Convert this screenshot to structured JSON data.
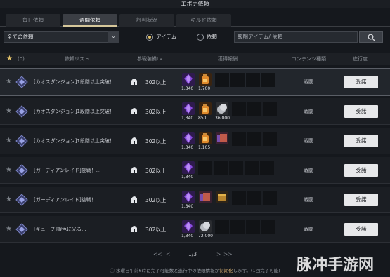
{
  "window": {
    "title": "エポナ依頼"
  },
  "tabs": [
    {
      "label": "毎日依頼",
      "active": false
    },
    {
      "label": "週間依頼",
      "active": true
    },
    {
      "label": "評判状況",
      "active": false
    },
    {
      "label": "ギルド依頼",
      "active": false
    }
  ],
  "filter": {
    "select_value": "全ての依頼",
    "radio_item": "アイテム",
    "radio_quest": "依頼",
    "search_placeholder": "報酬アイテム/ 依頼"
  },
  "table": {
    "fav_count": "(0)",
    "headers": {
      "list": "依頼リスト",
      "level": "参戦装備Lv",
      "reward": "獲得報酬",
      "content_type": "コンテンツ種類",
      "progress": "進行度"
    },
    "rows": [
      {
        "name": "[カオスダンジョン]1段階以上突破！",
        "level": "302以上",
        "rewards": [
          {
            "icon": "purple-crystal-icon",
            "count": "1,340"
          },
          {
            "icon": "orange-potion-icon",
            "count": "1,700"
          }
        ],
        "content_type": "戦闘",
        "action": "受諾",
        "selected": true
      },
      {
        "name": "[カオスダンジョン]1段階以上突破！",
        "level": "302以上",
        "rewards": [
          {
            "icon": "purple-crystal-icon",
            "count": "1,340"
          },
          {
            "icon": "orange-potion-icon",
            "count": "850"
          },
          {
            "icon": "silver-coin-icon",
            "count": "36,000"
          }
        ],
        "content_type": "戦闘",
        "action": "受諾",
        "selected": false
      },
      {
        "name": "[カオスダンジョン]1段階以上突破！",
        "level": "302以上",
        "rewards": [
          {
            "icon": "purple-crystal-icon",
            "count": "1,340"
          },
          {
            "icon": "orange-potion-icon",
            "count": "1,105"
          },
          {
            "icon": "card-pack-icon",
            "count": ""
          }
        ],
        "content_type": "戦闘",
        "action": "受諾",
        "selected": false
      },
      {
        "name": "[ガーディアンレイド]挑戦！...",
        "level": "302以上",
        "rewards": [
          {
            "icon": "purple-crystal-icon",
            "count": "1,340"
          }
        ],
        "content_type": "戦闘",
        "action": "受諾",
        "selected": false
      },
      {
        "name": "[ガーディアンレイド]挑戦！...",
        "level": "302以上",
        "rewards": [
          {
            "icon": "purple-crystal-icon",
            "count": "1,340"
          },
          {
            "icon": "card-pack-icon",
            "count": ""
          },
          {
            "icon": "gold-chest-icon",
            "count": ""
          }
        ],
        "content_type": "戦闘",
        "action": "受諾",
        "selected": false
      },
      {
        "name": "[キューブ]銀色に光る...",
        "level": "302以上",
        "rewards": [
          {
            "icon": "purple-crystal-icon",
            "count": "1,340"
          },
          {
            "icon": "silver-coin-icon",
            "count": "72,000"
          }
        ],
        "content_type": "戦闘",
        "action": "受諾",
        "selected": false
      }
    ]
  },
  "pager": {
    "page": "1/3"
  },
  "footer": {
    "before": "水曜日午前6時に完了可能数と進行中の依頼情報が",
    "highlight": "初期化",
    "after": "します。(1回完了可能)"
  },
  "watermark": "脉冲手游网",
  "colors": {
    "background": "#15181d",
    "accent_gold": "#e4c36a",
    "accept_button": "#e7e8ea",
    "crystal": "#7b3fd1"
  }
}
